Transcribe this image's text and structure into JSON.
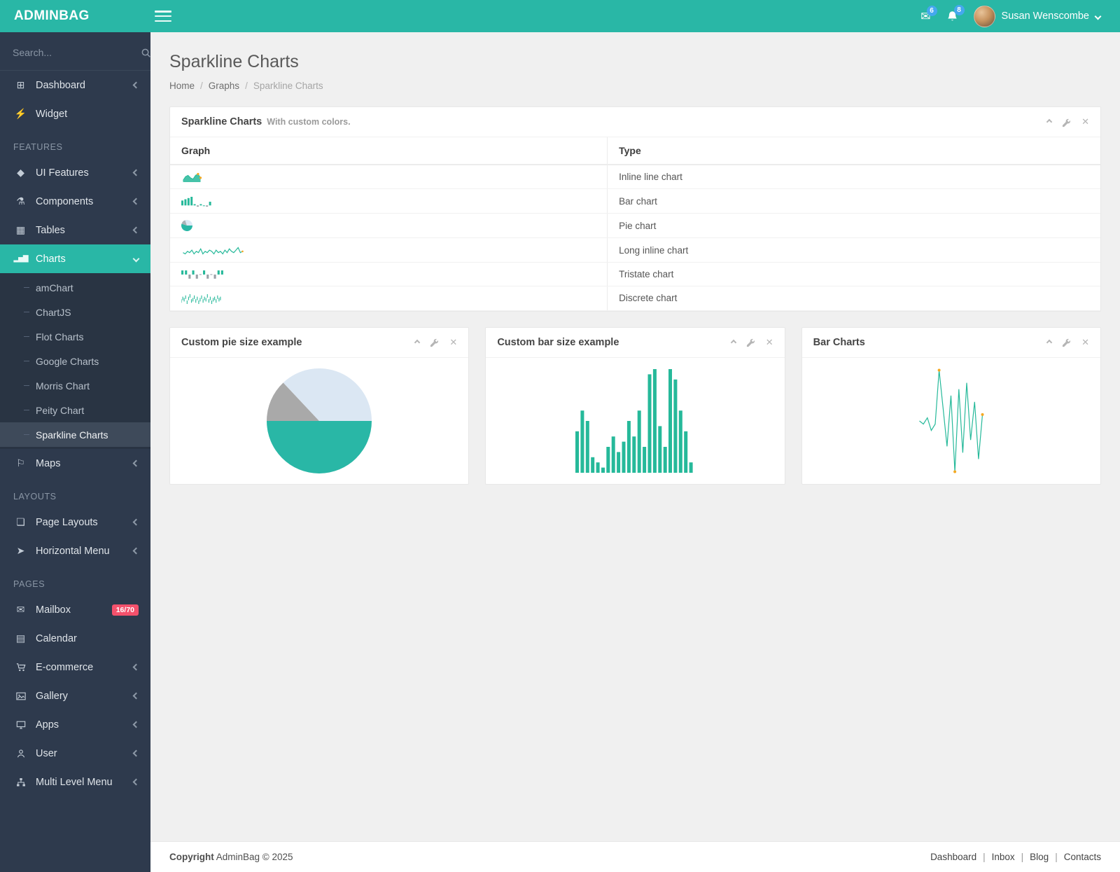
{
  "colors": {
    "accent": "#29b7a6",
    "spark_teal": "#26b99a",
    "marker_orange": "#f6a821",
    "sidebar_bg": "#2e3a4d",
    "badge_blue": "#45a8ee",
    "badge_red": "#f4516c"
  },
  "header": {
    "brand": "ADMINBAG",
    "user_name": "Susan Wenscombe",
    "mail_badge": "6",
    "bell_badge": "8"
  },
  "sidebar": {
    "search_placeholder": "Search...",
    "section_features": "FEATURES",
    "section_layouts": "LAYOUTS",
    "section_pages": "PAGES",
    "items": {
      "dashboard": "Dashboard",
      "widget": "Widget",
      "ui_features": "UI Features",
      "components": "Components",
      "tables": "Tables",
      "charts": "Charts",
      "maps": "Maps",
      "page_layouts": "Page Layouts",
      "horizontal_menu": "Horizontal Menu",
      "mailbox": "Mailbox",
      "mailbox_badge": "16/70",
      "calendar": "Calendar",
      "ecommerce": "E-commerce",
      "gallery": "Gallery",
      "apps": "Apps",
      "user": "User",
      "multi_level": "Multi Level Menu"
    },
    "charts_submenu": [
      "amChart",
      "ChartJS",
      "Flot Charts",
      "Google Charts",
      "Morris Chart",
      "Peity Chart",
      "Sparkline Charts"
    ]
  },
  "page": {
    "title": "Sparkline Charts",
    "breadcrumb": [
      "Home",
      "Graphs",
      "Sparkline Charts"
    ]
  },
  "panel": {
    "title": "Sparkline Charts",
    "subtitle": "With custom colors.",
    "table": {
      "headers": [
        "Graph",
        "Type"
      ],
      "rows": [
        {
          "type": "Inline line chart"
        },
        {
          "type": "Bar chart"
        },
        {
          "type": "Pie chart"
        },
        {
          "type": "Long inline chart"
        },
        {
          "type": "Tristate chart"
        },
        {
          "type": "Discrete chart"
        }
      ]
    }
  },
  "cards": {
    "pie": {
      "title": "Custom pie size example"
    },
    "bar": {
      "title": "Custom bar size example"
    },
    "line": {
      "title": "Bar Charts"
    }
  },
  "footer": {
    "copyright_bold": "Copyright",
    "copyright_rest": " AdminBag © 2025",
    "links": [
      "Dashboard",
      "Inbox",
      "Blog",
      "Contacts"
    ]
  },
  "chart_data": [
    {
      "id": "spark-inline-line",
      "type": "area",
      "title": "Inline line chart",
      "values": [
        2,
        5,
        6,
        4,
        3,
        6,
        7,
        4
      ],
      "color": "#26b99a",
      "marker_color": "#f6a821",
      "markers": [
        "max",
        "last"
      ],
      "marker_r": 1.6
    },
    {
      "id": "spark-bar",
      "type": "bar",
      "title": "Bar chart",
      "values": [
        4,
        5,
        6,
        7,
        1,
        -1,
        1,
        0,
        -1,
        3
      ],
      "color": "#26b99a",
      "neg_color": "#9aa0a6"
    },
    {
      "id": "spark-pie",
      "type": "pie",
      "title": "Pie chart",
      "values": [
        55,
        15,
        30
      ],
      "colors": [
        "#29b7a6",
        "#aab2b8",
        "#dce9f5"
      ],
      "start_angle": 0
    },
    {
      "id": "spark-long-line",
      "type": "line",
      "title": "Long inline chart",
      "values": [
        5,
        4,
        6,
        5,
        7,
        4,
        6,
        5,
        8,
        4,
        6,
        5,
        7,
        6,
        4,
        7,
        5,
        6,
        4,
        7,
        5,
        8,
        6,
        5,
        7,
        9,
        5,
        6
      ],
      "color": "#26b99a",
      "marker_color": "#f6a821",
      "markers": [
        "last"
      ],
      "marker_r": 1.3
    },
    {
      "id": "spark-tristate",
      "type": "tristate",
      "title": "Tristate chart",
      "values": [
        1,
        1,
        -1,
        1,
        -1,
        0,
        1,
        -1,
        0,
        -1,
        1,
        1
      ],
      "up": "#26b99a",
      "down": "#9aa0a6"
    },
    {
      "id": "spark-discrete",
      "type": "discrete",
      "title": "Discrete chart",
      "values": [
        4,
        6,
        5,
        7,
        3,
        6,
        8,
        4,
        5,
        7,
        4,
        6,
        3,
        5,
        7,
        4,
        6,
        5,
        8,
        4,
        6,
        3,
        5,
        6,
        4,
        7,
        5,
        6
      ],
      "color": "#26b99a"
    },
    {
      "id": "pie-large",
      "type": "pie",
      "title": "Custom pie size example",
      "values": [
        50,
        13,
        37
      ],
      "colors": [
        "#29b7a6",
        "#a9a9a9",
        "#dbe7f3"
      ],
      "start_angle": 0
    },
    {
      "id": "bar-large",
      "type": "bar",
      "title": "Custom bar size example",
      "values": [
        4,
        6,
        5,
        1.5,
        1,
        0.5,
        2.5,
        3.5,
        2,
        3,
        5,
        3.5,
        6,
        2.5,
        9.5,
        10,
        4.5,
        2.5,
        10,
        9,
        6,
        4,
        1
      ],
      "color": "#26b99a"
    },
    {
      "id": "line-large",
      "type": "line",
      "title": "Bar Charts",
      "values": [
        1,
        0.5,
        1.5,
        -0.5,
        0.5,
        9,
        3,
        -3,
        5,
        -7,
        6,
        -4,
        7,
        -2,
        4,
        -5,
        2
      ],
      "color": "#26b99a",
      "marker_color": "#f6a821",
      "markers": [
        "max",
        "min",
        "last"
      ],
      "marker_r": 2
    }
  ]
}
